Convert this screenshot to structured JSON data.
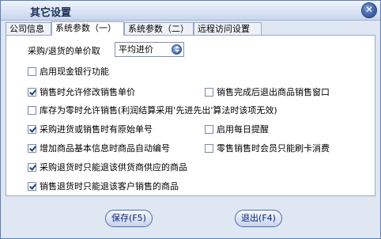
{
  "window": {
    "title": "其它设置",
    "close_icon": "close-icon",
    "close_glyph": "✕"
  },
  "tabs": [
    {
      "label": "公司信息",
      "active": false
    },
    {
      "label": "系统参数（一）",
      "active": true
    },
    {
      "label": "系统参数（二）",
      "active": false
    },
    {
      "label": "远程访问设置",
      "active": false
    }
  ],
  "price_select": {
    "label": "采购/退货的单价取",
    "value": "平均进价"
  },
  "options": {
    "enable_cash_bank": {
      "label": "启用现金银行功能",
      "checked": false
    },
    "allow_modify_sale_price": {
      "label": "销售时允许修改销售单价",
      "checked": true
    },
    "exit_sales_window_after_done": {
      "label": "销售完成后退出商品销售窗口",
      "checked": false
    },
    "allow_sale_when_zero_stock": {
      "label": "库存为零时允许销售(利润结算采用'先进先出'算法时该项无效)",
      "checked": false
    },
    "original_doc_no": {
      "label": "采购进货或销售时有原始单号",
      "checked": true
    },
    "daily_reminder": {
      "label": "启用每日提醒",
      "checked": false
    },
    "auto_item_code": {
      "label": "增加商品基本信息时商品自动编号",
      "checked": true
    },
    "member_card_only": {
      "label": "零售销售时会员只能刷卡消费",
      "checked": false
    },
    "purchase_return_supplier_only": {
      "label": "采购退货时只能退该供货商供应的商品",
      "checked": true
    },
    "sales_return_customer_only": {
      "label": "销售退货时只能退该客户销售的商品",
      "checked": true
    }
  },
  "buttons": {
    "save": "保存(F5)",
    "exit": "退出(F4)"
  },
  "colors": {
    "frame": "#5a7fb8",
    "background": "#dfe7f3",
    "button_text": "#0a1f7a"
  }
}
